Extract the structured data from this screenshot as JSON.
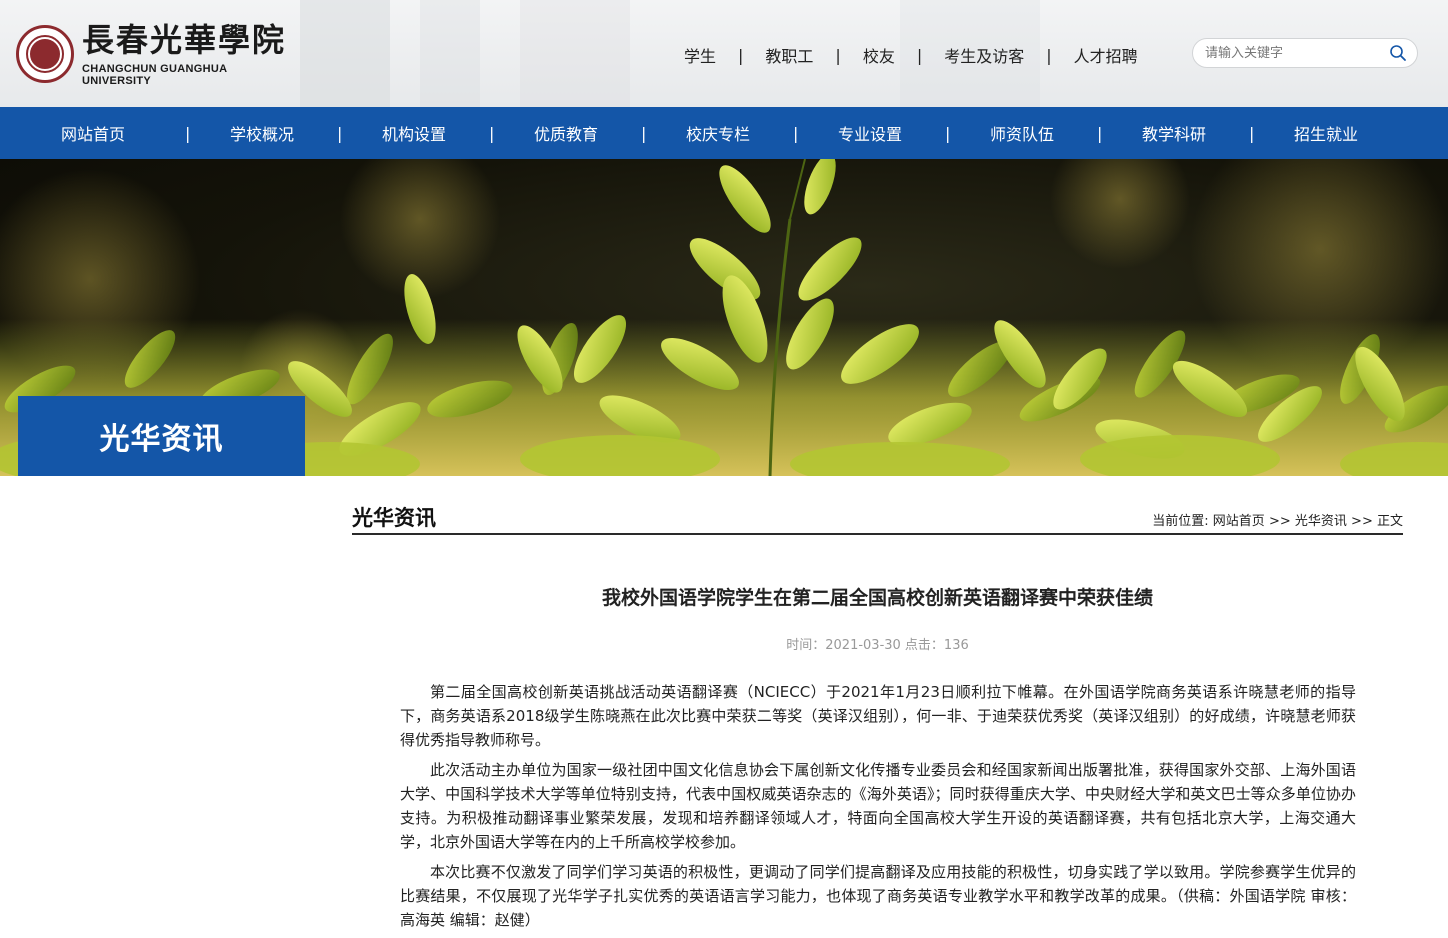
{
  "header": {
    "logo_cn": "長春光華學院",
    "logo_en": "CHANGCHUN GUANGHUA UNIVERSITY",
    "top_links": [
      "学生",
      "教职工",
      "校友",
      "考生及访客",
      "人才招聘"
    ],
    "separator": "|",
    "search_placeholder": "请输入关键字"
  },
  "nav": {
    "items": [
      "网站首页",
      "学校概况",
      "机构设置",
      "优质教育",
      "校庆专栏",
      "专业设置",
      "师资队伍",
      "教学科研",
      "招生就业"
    ],
    "separator": "|"
  },
  "banner": {
    "label": "光华资讯"
  },
  "section": {
    "title": "光华资讯",
    "breadcrumb_prefix": "当前位置:",
    "breadcrumb": [
      "网站首页",
      "光华资讯",
      "正文"
    ],
    "breadcrumb_sep": ">>"
  },
  "article": {
    "title": "我校外国语学院学生在第二届全国高校创新英语翻译赛中荣获佳绩",
    "meta": "时间：2021-03-30 点击：136",
    "paragraphs": [
      "第二届全国高校创新英语挑战活动英语翻译赛（NCIECC）于2021年1月23日顺利拉下帷幕。在外国语学院商务英语系许晓慧老师的指导下，商务英语系2018级学生陈晓燕在此次比赛中荣获二等奖（英译汉组别），何一非、于迪荣获优秀奖（英译汉组别）的好成绩，许晓慧老师获得优秀指导教师称号。",
      "此次活动主办单位为国家一级社团中国文化信息协会下属创新文化传播专业委员会和经国家新闻出版署批准，获得国家外交部、上海外国语大学、中国科学技术大学等单位特别支持，代表中国权威英语杂志的《海外英语》；同时获得重庆大学、中央财经大学和英文巴士等众多单位协办支持。为积极推动翻译事业繁荣发展，发现和培养翻译领域人才，特面向全国高校大学生开设的英语翻译赛，共有包括北京大学，上海交通大学，北京外国语大学等在内的上千所高校学校参加。",
      "本次比赛不仅激发了同学们学习英语的积极性，更调动了同学们提高翻译及应用技能的积极性，切身实践了学以致用。学院参赛学生优异的比赛结果，不仅展现了光华学子扎实优秀的英语语言学习能力，也体现了商务英语专业教学水平和教学改革的成果。（供稿：外国语学院 审核：高海英 编辑：赵健）"
    ]
  },
  "colors": {
    "nav_blue": "#1456a8",
    "logo_red": "#8c2a2e"
  },
  "icons": {
    "search": "search-icon",
    "seal": "university-seal-icon"
  }
}
